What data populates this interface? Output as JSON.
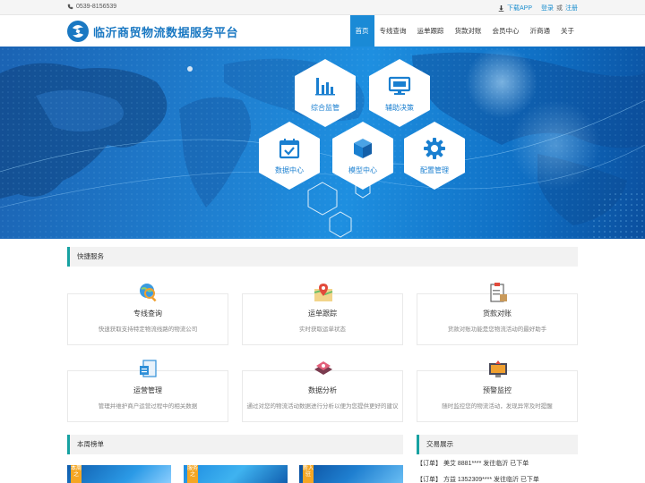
{
  "topbar": {
    "phone": "0539-8156539",
    "download": "下载APP",
    "login": "登录",
    "or": "或",
    "register": "注册"
  },
  "header": {
    "site_title": "临沂商贸物流数据服务平台",
    "nav": [
      {
        "label": "首页",
        "active": true
      },
      {
        "label": "专线查询"
      },
      {
        "label": "运单跟踪"
      },
      {
        "label": "货款对账"
      },
      {
        "label": "会员中心"
      },
      {
        "label": "沂商通"
      },
      {
        "label": "关于"
      }
    ]
  },
  "banner": {
    "hexes": [
      {
        "label": "综合监管",
        "icon": "bar-chart-icon"
      },
      {
        "label": "辅助决策",
        "icon": "monitor-icon"
      },
      {
        "label": "数据中心",
        "icon": "calendar-check-icon"
      },
      {
        "label": "模型中心",
        "icon": "cube-icon"
      },
      {
        "label": "配置管理",
        "icon": "gear-icon"
      }
    ]
  },
  "quick_services": {
    "title": "快捷服务",
    "cards": [
      {
        "title": "专线查询",
        "desc": "快速获取支持特定物流线路的物流公司",
        "icon": "globe-search-icon"
      },
      {
        "title": "运单跟踪",
        "desc": "实时获取运单状态",
        "icon": "map-pin-icon"
      },
      {
        "title": "货款对账",
        "desc": "货款对账功能是您物流活动的最好助手",
        "icon": "clipboard-icon"
      },
      {
        "title": "运营管理",
        "desc": "管理并维护商户运营过程中的相关数据",
        "icon": "document-icon"
      },
      {
        "title": "数据分析",
        "desc": "通过对您的物流活动数据进行分析以便为您提供更好的建议",
        "icon": "analysis-icon"
      },
      {
        "title": "预警监控",
        "desc": "随时监控您的物流活动，发现异常及时提醒",
        "icon": "monitor-alert-icon"
      }
    ]
  },
  "weekly": {
    "title": "本周榜单",
    "tags": [
      "本周之",
      "服务之",
      "新入驻"
    ]
  },
  "trades": {
    "title": "交易展示",
    "items": [
      "【订单】 美艾 8881**** 发往临沂 已下单",
      "【订单】 方益 1352309**** 发往临沂 已下单"
    ]
  },
  "colors": {
    "primary": "#1a8ad6",
    "accent": "#17a2a2"
  }
}
